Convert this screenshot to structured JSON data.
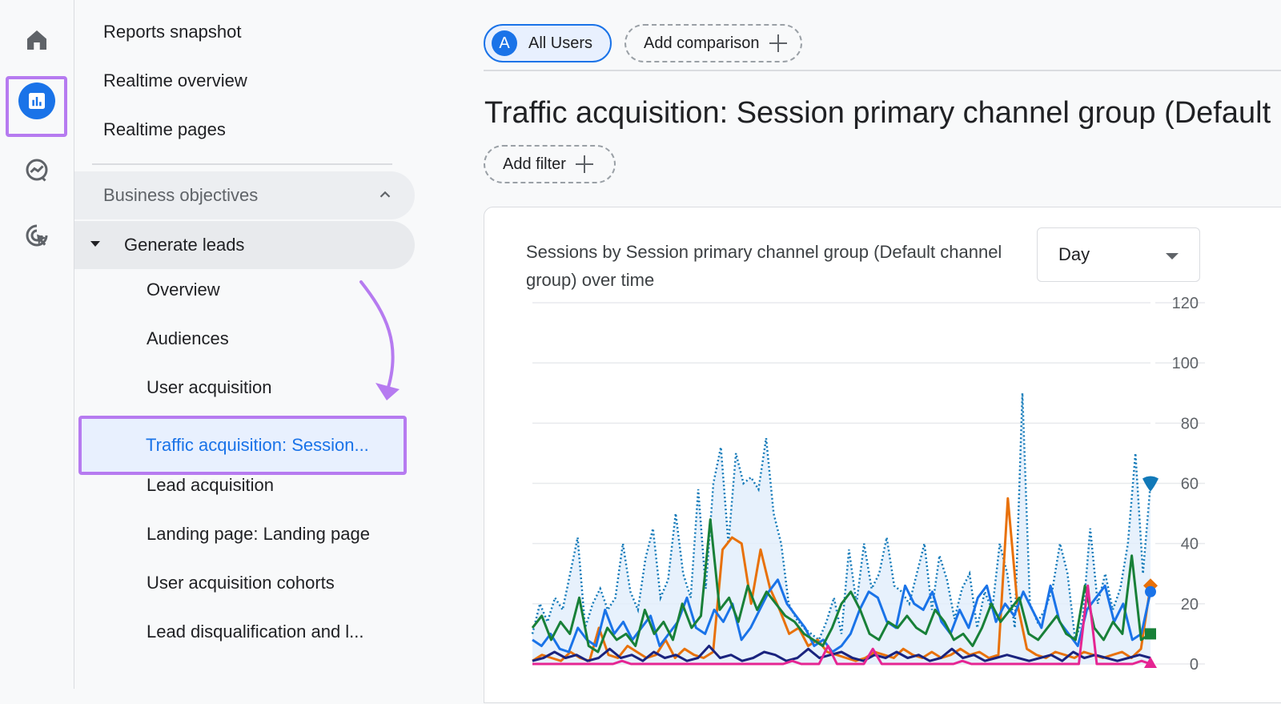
{
  "rail": {
    "items": [
      {
        "name": "home",
        "icon": "home-icon"
      },
      {
        "name": "reports",
        "icon": "bar-chart-icon"
      },
      {
        "name": "explore",
        "icon": "explore-icon"
      },
      {
        "name": "advertising",
        "icon": "cursor-target-icon"
      }
    ]
  },
  "nav": {
    "top_items": [
      "Reports snapshot",
      "Realtime overview",
      "Realtime pages"
    ],
    "section": "Business objectives",
    "group": "Generate leads",
    "sub_items": [
      "Overview",
      "Audiences",
      "User acquisition"
    ],
    "active_item": "Traffic acquisition: Session...",
    "sub_items_after": [
      "Lead acquisition",
      "Landing page: Landing page",
      "User acquisition cohorts",
      "Lead disqualification and l..."
    ]
  },
  "header": {
    "segment_avatar": "A",
    "segment_label": "All Users",
    "add_comparison": "Add comparison",
    "title": "Traffic acquisition: Session primary channel group (Default",
    "add_filter": "Add filter"
  },
  "card": {
    "title": "Sessions by Session primary channel group (Default channel group) over time",
    "granularity": "Day"
  },
  "chart_data": {
    "type": "line",
    "title": "Sessions by Session primary channel group (Default channel group) over time",
    "ylim": [
      0,
      120
    ],
    "yticks": [
      0,
      20,
      40,
      60,
      80,
      100,
      120
    ],
    "grid": true,
    "series": [
      {
        "color": "#1279b8",
        "style": "dotted-area",
        "marker": "shield",
        "values": [
          10,
          20,
          14,
          22,
          18,
          30,
          42,
          12,
          20,
          25,
          18,
          22,
          40,
          24,
          18,
          35,
          45,
          22,
          28,
          50,
          30,
          22,
          58,
          25,
          60,
          72,
          40,
          70,
          60,
          62,
          58,
          75,
          50,
          40,
          20,
          15,
          12,
          10,
          8,
          14,
          22,
          10,
          38,
          20,
          40,
          25,
          30,
          42,
          26,
          24,
          20,
          30,
          40,
          18,
          36,
          28,
          15,
          25,
          30,
          12,
          24,
          18,
          40,
          30,
          12,
          90,
          20,
          14,
          18,
          25,
          40,
          30,
          8,
          15,
          45,
          20,
          30,
          18,
          25,
          40,
          70,
          30,
          60
        ]
      },
      {
        "color": "#e8710a",
        "style": "solid",
        "marker": "diamond",
        "values": [
          1,
          3,
          2,
          1,
          4,
          2,
          1,
          12,
          3,
          2,
          6,
          4,
          2,
          3,
          8,
          2,
          5,
          3,
          2,
          4,
          38,
          42,
          40,
          20,
          38,
          25,
          18,
          10,
          12,
          6,
          8,
          4,
          3,
          2,
          1,
          2,
          4,
          3,
          2,
          5,
          3,
          2,
          4,
          2,
          3,
          5,
          3,
          4,
          2,
          3,
          55,
          20,
          5,
          3,
          2,
          4,
          3,
          2,
          4,
          3,
          2,
          3,
          4,
          2,
          5,
          26
        ]
      },
      {
        "color": "#1a73e8",
        "style": "solid",
        "marker": "circle",
        "values": [
          8,
          6,
          10,
          5,
          4,
          12,
          8,
          6,
          18,
          10,
          14,
          8,
          12,
          16,
          6,
          10,
          14,
          22,
          12,
          10,
          18,
          14,
          20,
          8,
          12,
          18,
          24,
          28,
          20,
          16,
          12,
          6,
          8,
          4,
          6,
          10,
          18,
          24,
          22,
          14,
          12,
          26,
          20,
          18,
          24,
          14,
          10,
          18,
          12,
          22,
          26,
          14,
          20,
          16,
          24,
          18,
          12,
          26,
          14,
          10,
          6,
          18,
          22,
          26,
          14,
          20,
          8,
          10,
          24
        ]
      },
      {
        "color": "#188038",
        "style": "solid",
        "marker": "square",
        "values": [
          12,
          16,
          8,
          14,
          10,
          22,
          6,
          4,
          12,
          8,
          10,
          6,
          18,
          10,
          14,
          8,
          20,
          12,
          16,
          48,
          18,
          22,
          14,
          26,
          18,
          24,
          20,
          16,
          14,
          10,
          8,
          6,
          12,
          20,
          24,
          18,
          10,
          8,
          14,
          12,
          16,
          12,
          10,
          18,
          14,
          8,
          10,
          6,
          12,
          20,
          14,
          18,
          22,
          10,
          8,
          12,
          16,
          10,
          8,
          26,
          12,
          8,
          14,
          10,
          36,
          8,
          10
        ]
      },
      {
        "color": "#1a237e",
        "style": "solid",
        "marker": "none",
        "values": [
          1,
          2,
          4,
          2,
          3,
          1,
          2,
          5,
          2,
          3,
          1,
          4,
          2,
          3,
          1,
          2,
          6,
          2,
          3,
          1,
          2,
          4,
          3,
          1,
          2,
          5,
          2,
          3,
          4,
          2,
          1,
          3,
          2,
          4,
          2,
          3,
          1,
          2,
          5,
          2,
          3,
          1,
          2,
          3,
          2,
          1,
          2,
          3,
          1,
          4,
          2,
          3,
          2,
          1,
          2,
          3,
          2
        ]
      },
      {
        "color": "#e52592",
        "style": "solid",
        "marker": "triangle",
        "values": [
          0,
          0,
          0,
          0,
          0,
          0,
          0,
          0,
          0,
          0,
          1,
          0,
          0,
          0,
          0,
          0,
          0,
          0,
          0,
          0,
          0,
          0,
          0,
          0,
          0,
          0,
          0,
          0,
          0,
          1,
          0,
          0,
          0,
          6,
          0,
          0,
          0,
          0,
          5,
          0,
          0,
          0,
          0,
          0,
          0,
          0,
          0,
          0,
          1,
          0,
          0,
          0,
          0,
          0,
          0,
          0,
          0,
          0,
          0,
          0,
          0,
          0,
          26,
          0,
          0,
          0,
          0,
          0,
          1,
          0
        ]
      }
    ]
  }
}
